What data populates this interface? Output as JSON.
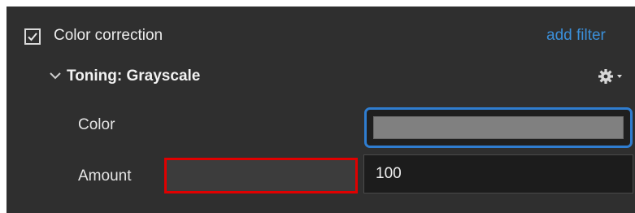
{
  "filter": {
    "enabled": true,
    "label": "Color correction",
    "add_filter_label": "add filter"
  },
  "section": {
    "title": "Toning: Grayscale",
    "expanded": true
  },
  "params": {
    "color_label": "Color",
    "color_value": "#808080",
    "amount_label": "Amount",
    "amount_value": "100"
  },
  "icons": {
    "checkbox": "checkbox-checked-icon",
    "chevron": "chevron-down-icon",
    "gear": "gear-dropdown-icon"
  },
  "colors": {
    "panel_bg": "#2f2f2f",
    "link": "#3b8fd9",
    "focus_border": "#2f7dd0",
    "highlight_border": "#e00000"
  }
}
